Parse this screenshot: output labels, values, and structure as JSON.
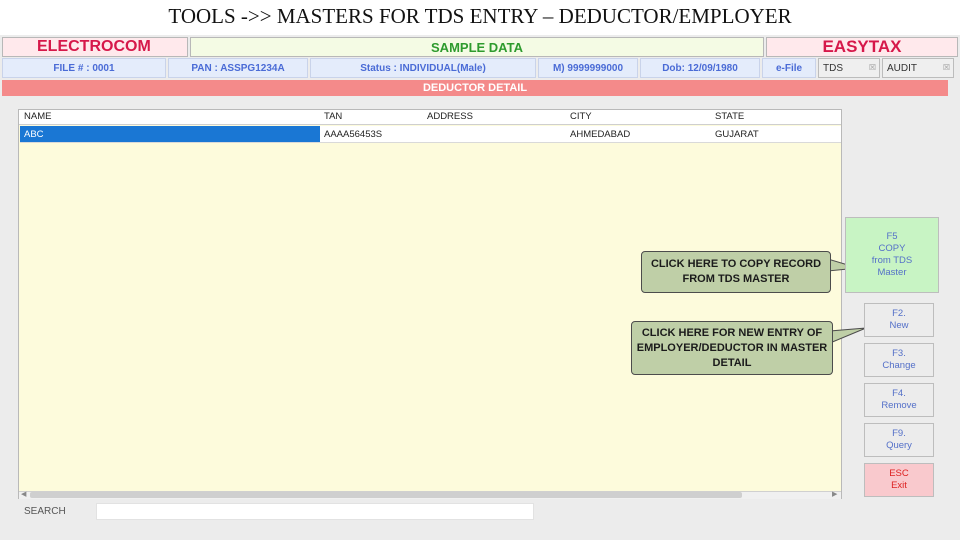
{
  "slide_title": "TOOLS ->> MASTERS FOR TDS ENTRY – DEDUCTOR/EMPLOYER",
  "header": {
    "brand_left": "ELECTROCOM",
    "center_title": "SAMPLE DATA",
    "brand_right": "EASYTAX"
  },
  "info_bar": {
    "file": "FILE # : 0001",
    "pan": "PAN : ASSPG1234A",
    "status": "Status : INDIVIDUAL(Male)",
    "mobile": "M) 9999999000",
    "dob": "Dob: 12/09/1980",
    "efile": "e-File",
    "tds_select": "TDS",
    "audit_select": "AUDIT"
  },
  "section_title": "DEDUCTOR DETAIL",
  "table": {
    "columns": [
      "NAME",
      "TAN",
      "ADDRESS",
      "CITY",
      "STATE"
    ],
    "rows": [
      {
        "name": "ABC",
        "tan": "AAAA56453S",
        "address": "",
        "city": "AHMEDABAD",
        "state": "GUJARAT"
      }
    ]
  },
  "search": {
    "label": "SEARCH",
    "value": ""
  },
  "buttons": {
    "copy": "F5\nCOPY\nfrom TDS\nMaster",
    "new": "F2.\nNew",
    "change": "F3.\nChange",
    "remove": "F4.\nRemove",
    "query": "F9.\nQuery",
    "exit": "ESC\nExit"
  },
  "callouts": {
    "copy": "CLICK HERE TO COPY RECORD FROM TDS MASTER",
    "new": "CLICK HERE FOR NEW ENTRY OF EMPLOYER/DEDUCTOR IN MASTER DETAIL"
  },
  "colors": {
    "brand": "#d6184a",
    "accent_green": "#2e9b2e",
    "section_bar": "#f48a8a",
    "selected_row": "#1a77d4",
    "grid_bg": "#fdfbdc",
    "callout_bg": "#bfcfa7"
  }
}
